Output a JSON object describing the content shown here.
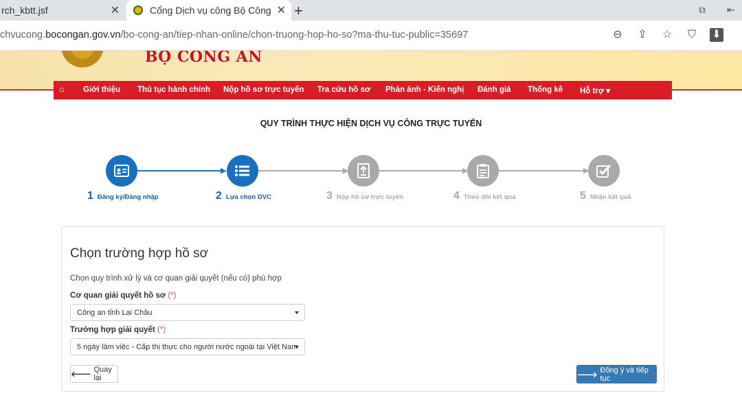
{
  "browser": {
    "tabs": [
      {
        "title": "rch_kbtt.jsf"
      },
      {
        "title": "Cổng Dịch vụ công Bộ Công"
      }
    ],
    "url_prefix": "chvucong.",
    "url_host": "bocongan.gov.vn",
    "url_path": "/bo-cong-an/tiep-nhan-online/chon-truong-hop-ho-so?ma-thu-tuc-public=35697"
  },
  "header": {
    "brand": "BỘ CÔNG AN"
  },
  "nav": {
    "items": [
      "Giới thiệu",
      "Thủ tục hành chính",
      "Nộp hồ sơ trực tuyến",
      "Tra cứu hồ sơ",
      "Phản ánh - Kiến nghị",
      "Đánh giá",
      "Thống kê",
      "Hỗ trợ ▾"
    ]
  },
  "process": {
    "title": "QUY TRÌNH THỰC HIỆN DỊCH VỤ CÔNG TRỰC TUYẾN",
    "steps": [
      {
        "num": "1",
        "label": "Đăng ký/Đăng nhập",
        "state": "active",
        "icon": "id-card-icon"
      },
      {
        "num": "2",
        "label": "Lựa chọn DVC",
        "state": "active",
        "icon": "list-icon"
      },
      {
        "num": "3",
        "label": "Nộp hồ sơ trực tuyến",
        "state": "inactive",
        "icon": "document-upload-icon"
      },
      {
        "num": "4",
        "label": "Theo dõi kết quả",
        "state": "inactive",
        "icon": "clipboard-icon"
      },
      {
        "num": "5",
        "label": "Nhận kết quả",
        "state": "inactive",
        "icon": "checkbox-icon"
      }
    ]
  },
  "form": {
    "title": "Chọn trường hợp hồ sơ",
    "description": "Chọn quy trình xử lý và cơ quan giải quyết (nếu có) phù hợp",
    "agency_label": "Cơ quan giải quyết hồ sơ",
    "agency_value": "Công an tỉnh Lai Châu",
    "case_label": "Trường hợp giải quyết",
    "case_value": "5 ngày làm việc - Cấp thị thực cho người nước ngoài tại Việt Nam",
    "required_mark": "(*)",
    "back_label": "Quay lại",
    "next_label": "Đồng ý và tiếp tục"
  },
  "colors": {
    "nav_red": "#d71e26",
    "step_active": "#1a6fbe",
    "step_inactive": "#a9a9a9",
    "primary_button": "#337ab7"
  }
}
